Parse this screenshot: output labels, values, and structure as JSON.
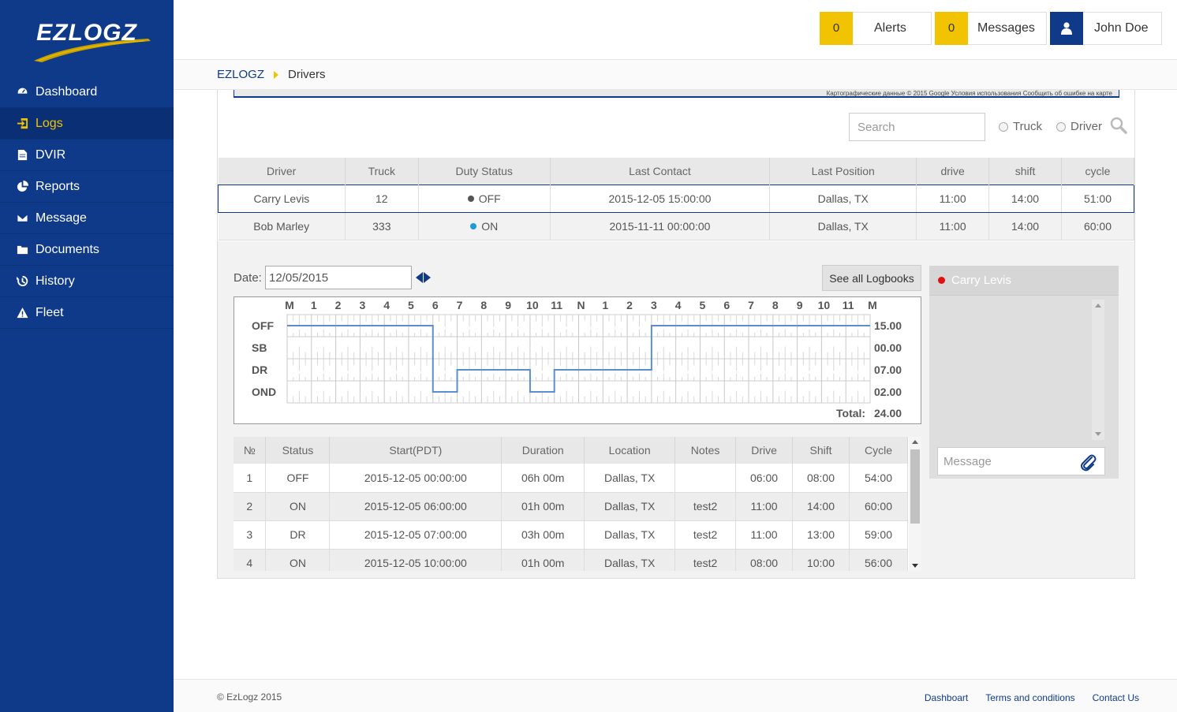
{
  "brand": {
    "logo_text": "EZLOGZ"
  },
  "sidebar": {
    "items": [
      {
        "label": "Dashboard",
        "icon": "dashboard-icon"
      },
      {
        "label": "Logs",
        "icon": "sign-in-icon",
        "active": true
      },
      {
        "label": "DVIR",
        "icon": "document-icon"
      },
      {
        "label": "Reports",
        "icon": "pie-chart-icon"
      },
      {
        "label": "Message",
        "icon": "envelope-icon"
      },
      {
        "label": "Documents",
        "icon": "folder-icon"
      },
      {
        "label": "History",
        "icon": "history-icon"
      },
      {
        "label": "Fleet",
        "icon": "warning-triangle-icon"
      }
    ]
  },
  "header": {
    "alerts_count": "0",
    "alerts_label": "Alerts",
    "messages_count": "0",
    "messages_label": "Messages",
    "user_name": "John Doe"
  },
  "breadcrumb": {
    "root": "EZLOGZ",
    "current": "Drivers"
  },
  "map": {
    "attribution": "Картографические данные © 2015 Google   Условия использования   Сообщить об ошибке на карте"
  },
  "search": {
    "placeholder": "Search",
    "radio_truck": "Truck",
    "radio_driver": "Driver"
  },
  "drivers_table": {
    "headers": [
      "Driver",
      "Truck",
      "Duty Status",
      "Last Contact",
      "Last Position",
      "drive",
      "shift",
      "cycle"
    ],
    "rows": [
      {
        "driver": "Carry Levis",
        "truck": "12",
        "status": "OFF",
        "status_color": "#555555",
        "last_contact": "2015-12-05 15:00:00",
        "position": "Dallas, TX",
        "drive": "11:00",
        "shift": "14:00",
        "cycle": "51:00"
      },
      {
        "driver": "Bob Marley",
        "truck": "333",
        "status": "ON",
        "status_color": "#1e9ad6",
        "last_contact": "2015-11-11 00:00:00",
        "position": "Dallas, TX",
        "drive": "11:00",
        "shift": "14:00",
        "cycle": "60:00"
      }
    ]
  },
  "logbook": {
    "date_label": "Date:",
    "date_value": "12/05/2015",
    "see_all_label": "See all Logbooks",
    "graph": {
      "hour_labels": [
        "M",
        "1",
        "2",
        "3",
        "4",
        "5",
        "6",
        "7",
        "8",
        "9",
        "10",
        "11",
        "N",
        "1",
        "2",
        "3",
        "4",
        "5",
        "6",
        "7",
        "8",
        "9",
        "10",
        "11",
        "M"
      ],
      "rows": [
        "OFF",
        "SB",
        "DR",
        "OND"
      ],
      "totals": [
        "15.00",
        "00.00",
        "07.00",
        "02.00"
      ],
      "total_label": "Total:",
      "total_value": "24.00",
      "line_color": "#5b8ed0",
      "segments": [
        {
          "status": "OFF",
          "start": 0,
          "end": 6
        },
        {
          "status": "OND",
          "start": 6,
          "end": 7
        },
        {
          "status": "DR",
          "start": 7,
          "end": 10
        },
        {
          "status": "OND",
          "start": 10,
          "end": 11
        },
        {
          "status": "DR",
          "start": 11,
          "end": 15
        },
        {
          "status": "OFF",
          "start": 15,
          "end": 24
        }
      ]
    },
    "table": {
      "headers": [
        "№",
        "Status",
        "Start(PDT)",
        "Duration",
        "Location",
        "Notes",
        "Drive",
        "Shift",
        "Cycle"
      ],
      "rows": [
        {
          "n": "1",
          "status": "OFF",
          "start": "2015-12-05 00:00:00",
          "duration": "06h 00m",
          "location": "Dallas, TX",
          "notes": "",
          "drive": "06:00",
          "shift": "08:00",
          "cycle": "54:00"
        },
        {
          "n": "2",
          "status": "ON",
          "start": "2015-12-05 06:00:00",
          "duration": "01h 00m",
          "location": "Dallas, TX",
          "notes": "test2",
          "drive": "11:00",
          "shift": "14:00",
          "cycle": "60:00"
        },
        {
          "n": "3",
          "status": "DR",
          "start": "2015-12-05 07:00:00",
          "duration": "03h 00m",
          "location": "Dallas, TX",
          "notes": "test2",
          "drive": "11:00",
          "shift": "13:00",
          "cycle": "59:00"
        },
        {
          "n": "4",
          "status": "ON",
          "start": "2015-12-05 10:00:00",
          "duration": "01h 00m",
          "location": "Dallas, TX",
          "notes": "test2",
          "drive": "08:00",
          "shift": "10:00",
          "cycle": "56:00"
        }
      ]
    }
  },
  "chat": {
    "driver_name": "Carry Levis",
    "message_placeholder": "Message"
  },
  "footer": {
    "copyright": "© EzLogz 2015",
    "links": [
      "Dashboart",
      "Terms and conditions",
      "Contact Us"
    ]
  }
}
